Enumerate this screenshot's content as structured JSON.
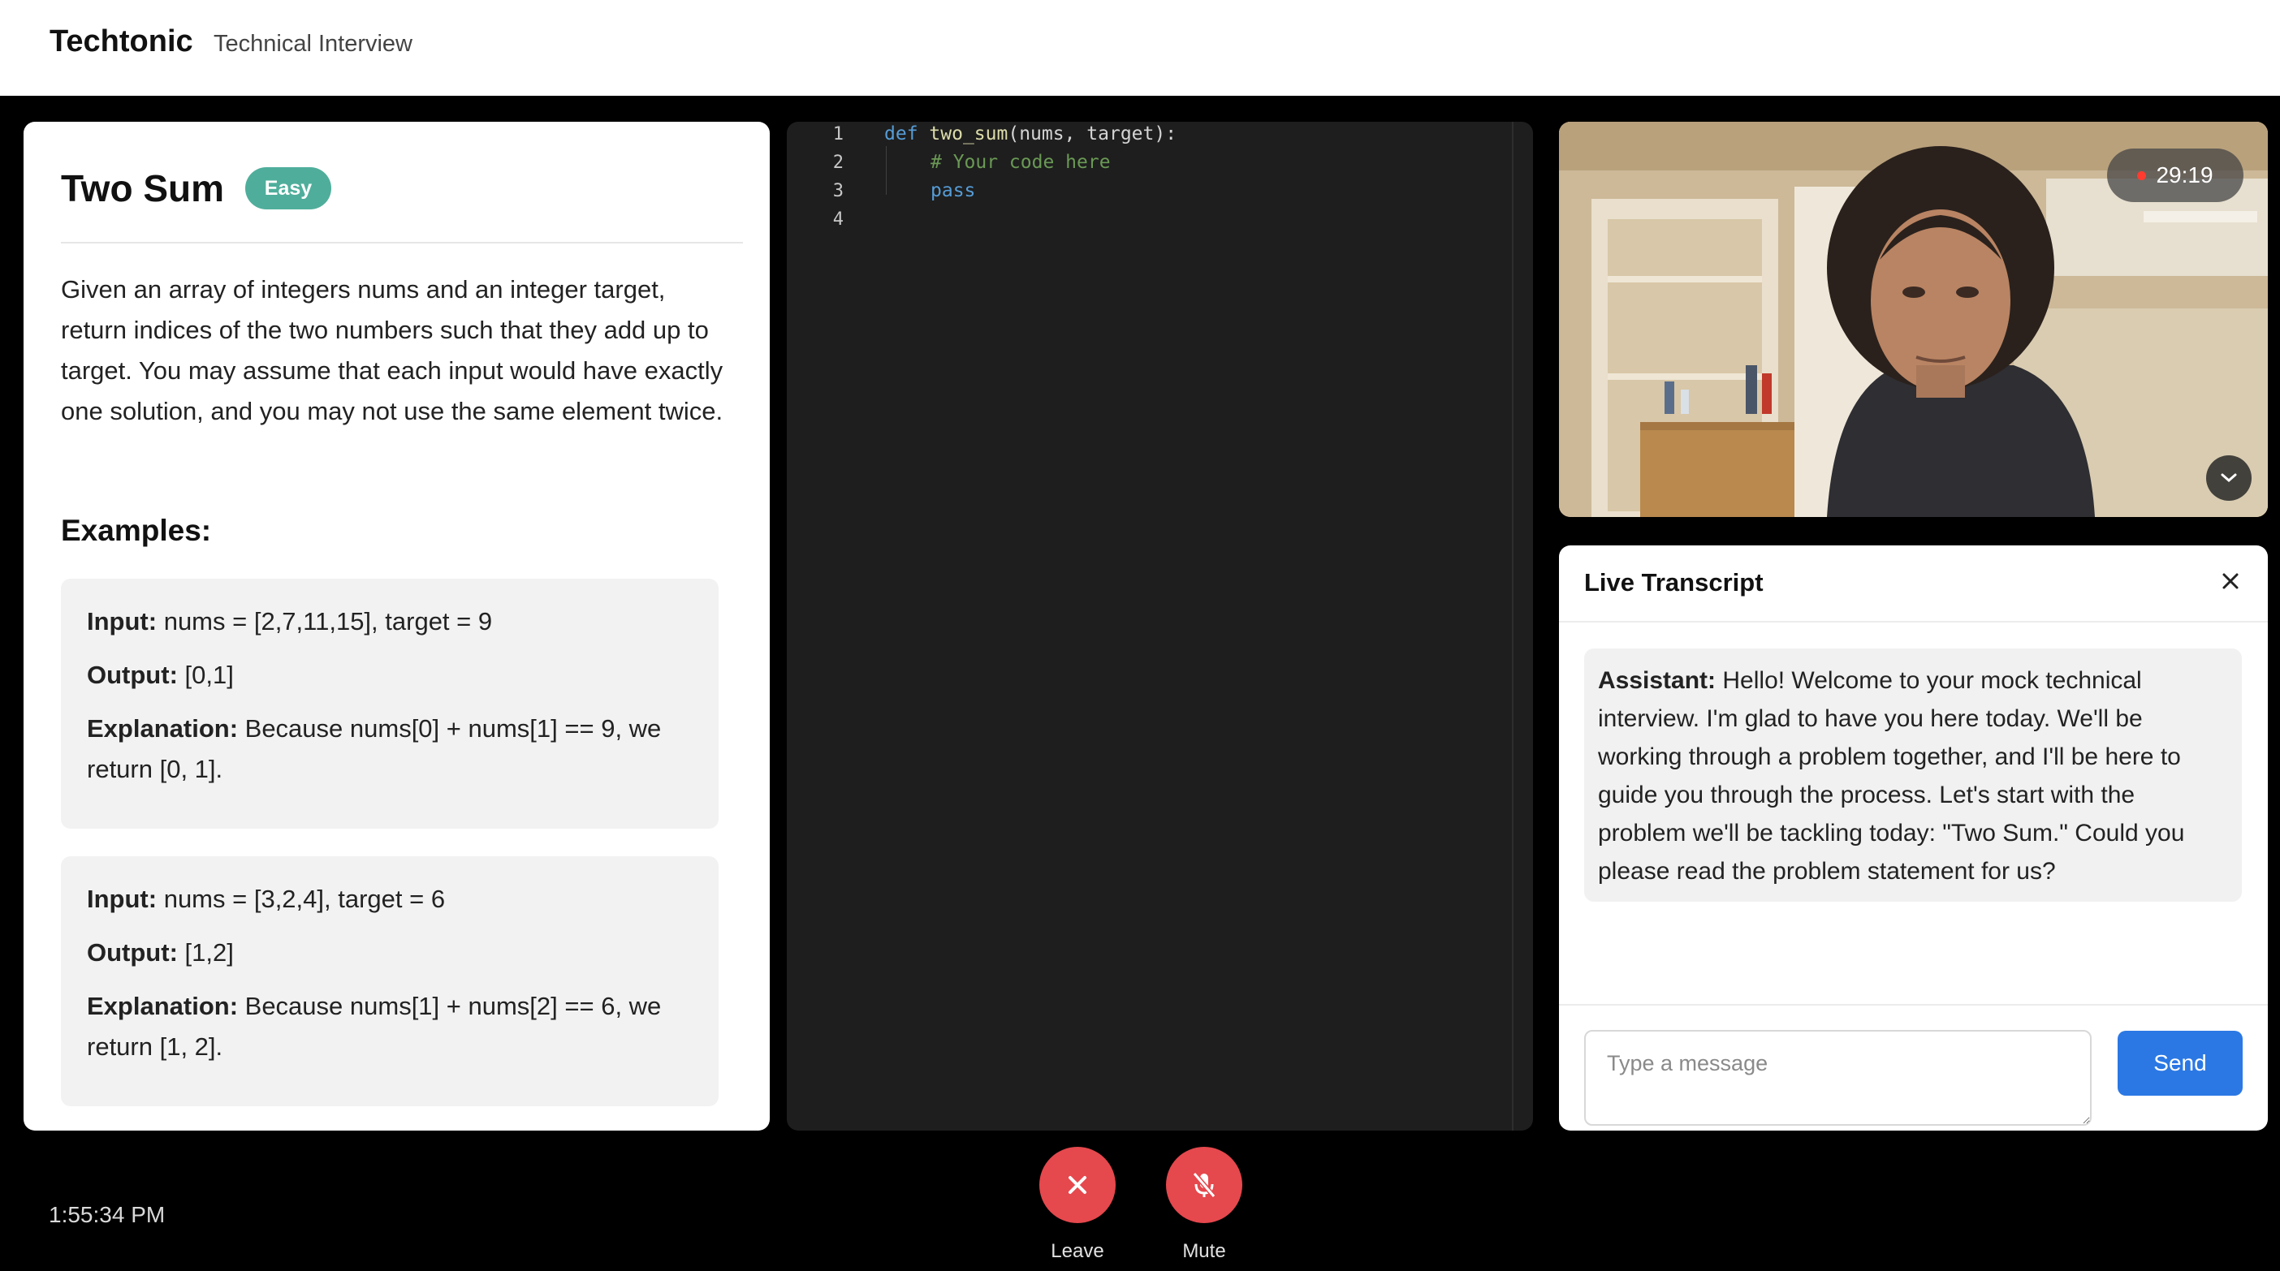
{
  "header": {
    "brand": "Techtonic",
    "subtitle": "Technical Interview"
  },
  "problem": {
    "title": "Two Sum",
    "difficulty": "Easy",
    "description": "Given an array of integers nums and an integer target, return indices of the two numbers such that they add up to target. You may assume that each input would have exactly one solution, and you may not use the same element twice.",
    "examples_heading": "Examples:",
    "labels": {
      "input": "Input:",
      "output": "Output:",
      "explanation": "Explanation:"
    },
    "examples": [
      {
        "input": "nums = [2,7,11,15], target = 9",
        "output": "[0,1]",
        "explanation": "Because nums[0] + nums[1] == 9, we return [0, 1]."
      },
      {
        "input": "nums = [3,2,4], target = 6",
        "output": "[1,2]",
        "explanation": "Because nums[1] + nums[2] == 6, we return [1, 2]."
      }
    ]
  },
  "editor": {
    "line_numbers": [
      "1",
      "2",
      "3",
      "4"
    ],
    "code": {
      "line1_kw": "def",
      "line1_fn": "two_sum",
      "line1_rest": "(nums, target):",
      "line2_comment": "# Your code here",
      "line3_kw": "pass"
    }
  },
  "video": {
    "timer": "29:19",
    "icon": "chevron-down-icon"
  },
  "transcript": {
    "title": "Live Transcript",
    "messages": [
      {
        "speaker": "Assistant:",
        "text": "Hello! Welcome to your mock technical interview. I'm glad to have you here today. We'll be working through a problem together, and I'll be here to guide you through the process. Let's start with the problem we'll be tackling today: \"Two Sum.\" Could you please read the problem statement for us?"
      }
    ],
    "input_placeholder": "Type a message",
    "send_label": "Send"
  },
  "footer": {
    "clock": "1:55:34 PM",
    "leave_label": "Leave",
    "mute_label": "Mute"
  },
  "colors": {
    "badge": "#4fae9b",
    "send": "#2b78e4",
    "control": "#e5484d",
    "editor_bg": "#1e1e1e"
  }
}
